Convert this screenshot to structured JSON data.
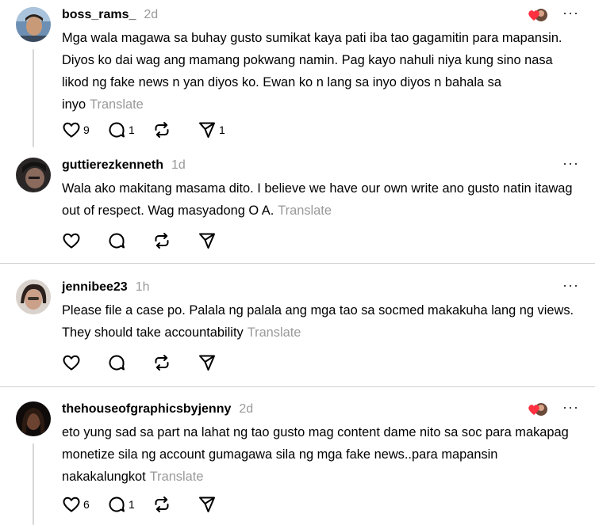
{
  "translate_label": "Translate",
  "more_glyph": "···",
  "posts": [
    {
      "username": "boss_rams_",
      "time": "2d",
      "text": "Mga wala magawa sa buhay gusto sumikat kaya pati iba tao gagamitin para mapansin. Diyos ko dai wag ang mamang pokwang namin. Pag kayo nahuli niya kung sino nasa likod ng fake news n yan diyos ko. Ewan ko n lang sa inyo diyos n bahala sa inyo",
      "likes": "9",
      "replies": "1",
      "reposts": "",
      "shares": "1"
    },
    {
      "username": "guttierezkenneth",
      "time": "1d",
      "text": "Wala ako makitang masama dito. I believe we have our own write ano gusto natin itawag out of respect. Wag masyadong O A.",
      "likes": "",
      "replies": "",
      "reposts": "",
      "shares": ""
    },
    {
      "username": "jennibee23",
      "time": "1h",
      "text": "Please file a case po. Palala ng palala ang mga tao sa socmed makakuha lang ng views. They should take accountability",
      "likes": "",
      "replies": "",
      "reposts": "",
      "shares": ""
    },
    {
      "username": "thehouseofgraphicsbyjenny",
      "time": "2d",
      "text": "eto yung sad sa part na lahat ng tao gusto mag content dame nito sa soc para makapag monetize sila ng account gumagawa sila ng mga fake news..para mapansin nakakalungkot",
      "likes": "6",
      "replies": "1",
      "reposts": "",
      "shares": ""
    }
  ],
  "colors": {
    "muted": "#999999",
    "heart": "#ff3040",
    "divider": "#cfcfcf"
  }
}
